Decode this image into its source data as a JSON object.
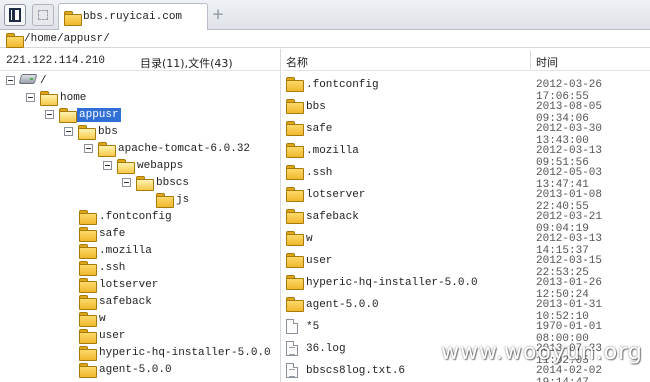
{
  "tab": {
    "title": "bbs.ruyicai.com",
    "add_symbol": "+"
  },
  "path": "/home/appusr/",
  "left": {
    "ip": "221.122.114.210",
    "stats": "目录(11),文件(43)",
    "tree": [
      {
        "label": "/",
        "icon": "drive-icon",
        "expanded": true
      },
      {
        "label": "home",
        "icon": "folder-icon",
        "expanded": true
      },
      {
        "label": "appusr",
        "icon": "folder-icon",
        "expanded": true,
        "selected": true
      },
      {
        "label": "bbs",
        "icon": "folder-icon",
        "expanded": true
      },
      {
        "label": "apache-tomcat-6.0.32",
        "icon": "folder-icon",
        "expanded": true
      },
      {
        "label": "webapps",
        "icon": "folder-icon",
        "expanded": true
      },
      {
        "label": "bbscs",
        "icon": "folder-icon",
        "expanded": true
      },
      {
        "label": "js",
        "icon": "folder-icon"
      },
      {
        "label": ".fontconfig",
        "icon": "folder-icon"
      },
      {
        "label": "safe",
        "icon": "folder-icon"
      },
      {
        "label": ".mozilla",
        "icon": "folder-icon"
      },
      {
        "label": ".ssh",
        "icon": "folder-icon"
      },
      {
        "label": "lotserver",
        "icon": "folder-icon"
      },
      {
        "label": "safeback",
        "icon": "folder-icon"
      },
      {
        "label": "w",
        "icon": "folder-icon"
      },
      {
        "label": "user",
        "icon": "folder-icon"
      },
      {
        "label": "hyperic-hq-installer-5.0.0",
        "icon": "folder-icon"
      },
      {
        "label": "agent-5.0.0",
        "icon": "folder-icon"
      }
    ]
  },
  "right": {
    "col_name": "名称",
    "col_time": "时间",
    "files": [
      {
        "name": ".fontconfig",
        "time": "2012-03-26 17:06:55",
        "icon": "folder-icon"
      },
      {
        "name": "bbs",
        "time": "2013-08-05 09:34:06",
        "icon": "folder-icon"
      },
      {
        "name": "safe",
        "time": "2012-03-30 13:43:00",
        "icon": "folder-icon"
      },
      {
        "name": ".mozilla",
        "time": "2012-03-13 09:51:56",
        "icon": "folder-icon"
      },
      {
        "name": ".ssh",
        "time": "2012-05-03 13:47:41",
        "icon": "folder-icon"
      },
      {
        "name": "lotserver",
        "time": "2013-01-08 22:40:55",
        "icon": "folder-icon"
      },
      {
        "name": "safeback",
        "time": "2012-03-21 09:04:19",
        "icon": "folder-icon"
      },
      {
        "name": "w",
        "time": "2012-03-13 14:15:37",
        "icon": "folder-icon"
      },
      {
        "name": "user",
        "time": "2012-03-15 22:53:25",
        "icon": "folder-icon"
      },
      {
        "name": "hyperic-hq-installer-5.0.0",
        "time": "2013-01-26 12:50:24",
        "icon": "folder-icon"
      },
      {
        "name": "agent-5.0.0",
        "time": "2013-01-31 10:52:10",
        "icon": "folder-icon"
      },
      {
        "name": "*5",
        "time": "1970-01-01 08:00:00",
        "icon": "file-icon"
      },
      {
        "name": "36.log",
        "time": "2013-07-23 11:02:05",
        "icon": "file-icon"
      },
      {
        "name": "bbscs8log.txt.6",
        "time": "2014-02-02 19:14:47",
        "icon": "file-icon"
      }
    ]
  },
  "watermark": "www.wooyun.org",
  "colors": {
    "selection": "#2f6fd6",
    "folder": "#f0b82c"
  }
}
